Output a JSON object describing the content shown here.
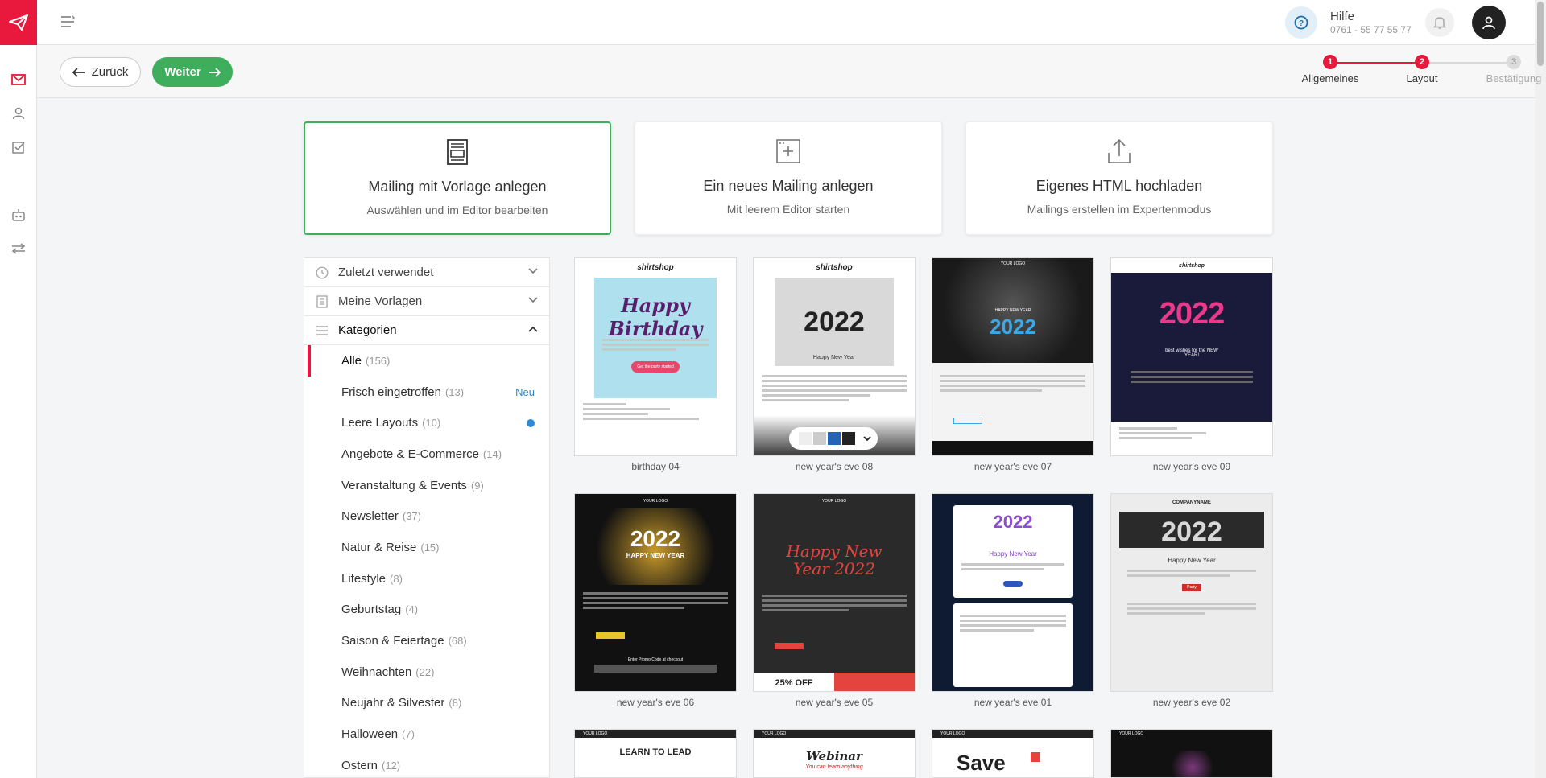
{
  "header": {
    "help_title": "Hilfe",
    "help_phone": "0761 - 55 77 55 77"
  },
  "actions": {
    "back_label": "Zurück",
    "next_label": "Weiter"
  },
  "steps": [
    {
      "number": "1",
      "label": "Allgemeines",
      "state": "done"
    },
    {
      "number": "2",
      "label": "Layout",
      "state": "current"
    },
    {
      "number": "3",
      "label": "Bestätigung",
      "state": "pending"
    }
  ],
  "cards": [
    {
      "title": "Mailing mit Vorlage anlegen",
      "subtitle": "Auswählen und im Editor bearbeiten",
      "icon": "template-icon",
      "selected": true
    },
    {
      "title": "Ein neues Mailing anlegen",
      "subtitle": "Mit leerem Editor starten",
      "icon": "new-layout-icon",
      "selected": false
    },
    {
      "title": "Eigenes HTML hochladen",
      "subtitle": "Mailings erstellen im Expertenmodus",
      "icon": "upload-icon",
      "selected": false
    }
  ],
  "sidebar": {
    "sections": [
      {
        "label": "Zuletzt verwendet",
        "icon": "clock-icon",
        "open": false
      },
      {
        "label": "Meine Vorlagen",
        "icon": "document-icon",
        "open": false
      },
      {
        "label": "Kategorien",
        "icon": "list-icon",
        "open": true
      }
    ],
    "categories": [
      {
        "name": "Alle",
        "count": "(156)",
        "active": true
      },
      {
        "name": "Frisch eingetroffen",
        "count": "(13)",
        "badge": "Neu"
      },
      {
        "name": "Leere Layouts",
        "count": "(10)",
        "dot": true
      },
      {
        "name": "Angebote & E-Commerce",
        "count": "(14)"
      },
      {
        "name": "Veranstaltung & Events",
        "count": "(9)"
      },
      {
        "name": "Newsletter",
        "count": "(37)"
      },
      {
        "name": "Natur & Reise",
        "count": "(15)"
      },
      {
        "name": "Lifestyle",
        "count": "(8)"
      },
      {
        "name": "Geburtstag",
        "count": "(4)"
      },
      {
        "name": "Saison & Feiertage",
        "count": "(68)"
      },
      {
        "name": "Weihnachten",
        "count": "(22)"
      },
      {
        "name": "Neujahr & Silvester",
        "count": "(8)"
      },
      {
        "name": "Halloween",
        "count": "(7)"
      },
      {
        "name": "Ostern",
        "count": "(12)"
      }
    ]
  },
  "templates": [
    {
      "label": "birthday 04",
      "brand": "shirtshop",
      "headline": "Happy Birthday",
      "button": "Get the party started",
      "theme": "birthday"
    },
    {
      "label": "new year's eve 08",
      "brand": "shirtshop",
      "headline": "2022",
      "sub": "Happy New Year",
      "theme": "grey"
    },
    {
      "label": "new year's eve 07",
      "brand": "YOUR LOGO",
      "headline": "2022",
      "sub": "HAPPY NEW YEAR",
      "theme": "forest"
    },
    {
      "label": "new year's eve 09",
      "brand": "shirtshop",
      "headline": "2022",
      "sub": "best wishes for the NEW YEAR!",
      "theme": "navy"
    },
    {
      "label": "new year's eve 06",
      "brand": "YOUR LOGO",
      "headline": "2022",
      "sub": "HAPPY NEW YEAR",
      "extra": "Enter Promo Code at checkout",
      "theme": "black"
    },
    {
      "label": "new year's eve 05",
      "brand": "YOUR LOGO",
      "headline": "Happy New Year 2022",
      "promo": "25% OFF",
      "theme": "darkred"
    },
    {
      "label": "new year's eve 01",
      "brand": "",
      "headline": "2022",
      "sub": "Happy New Year",
      "theme": "party"
    },
    {
      "label": "new year's eve 02",
      "brand": "COMPANYNAME",
      "headline": "2022",
      "sub": "Happy New Year",
      "button": "Party",
      "theme": "light"
    },
    {
      "label": "",
      "brand": "YOUR LOGO",
      "headline": "LEARN TO LEAD",
      "theme": "bottom"
    },
    {
      "label": "",
      "brand": "YOUR LOGO",
      "headline": "Webinar",
      "sub": "You can learn anything",
      "theme": "bottom"
    },
    {
      "label": "",
      "brand": "YOUR LOGO",
      "headline": "Save",
      "theme": "bottom"
    },
    {
      "label": "",
      "brand": "YOUR LOGO",
      "headline": "",
      "theme": "bottomdark"
    }
  ],
  "hover_toolbar": {
    "visible_on": "new year's eve 08"
  },
  "colors": {
    "brand_red": "#e8193c",
    "accent_green": "#3fae5c",
    "link_blue": "#2c8ad6"
  }
}
